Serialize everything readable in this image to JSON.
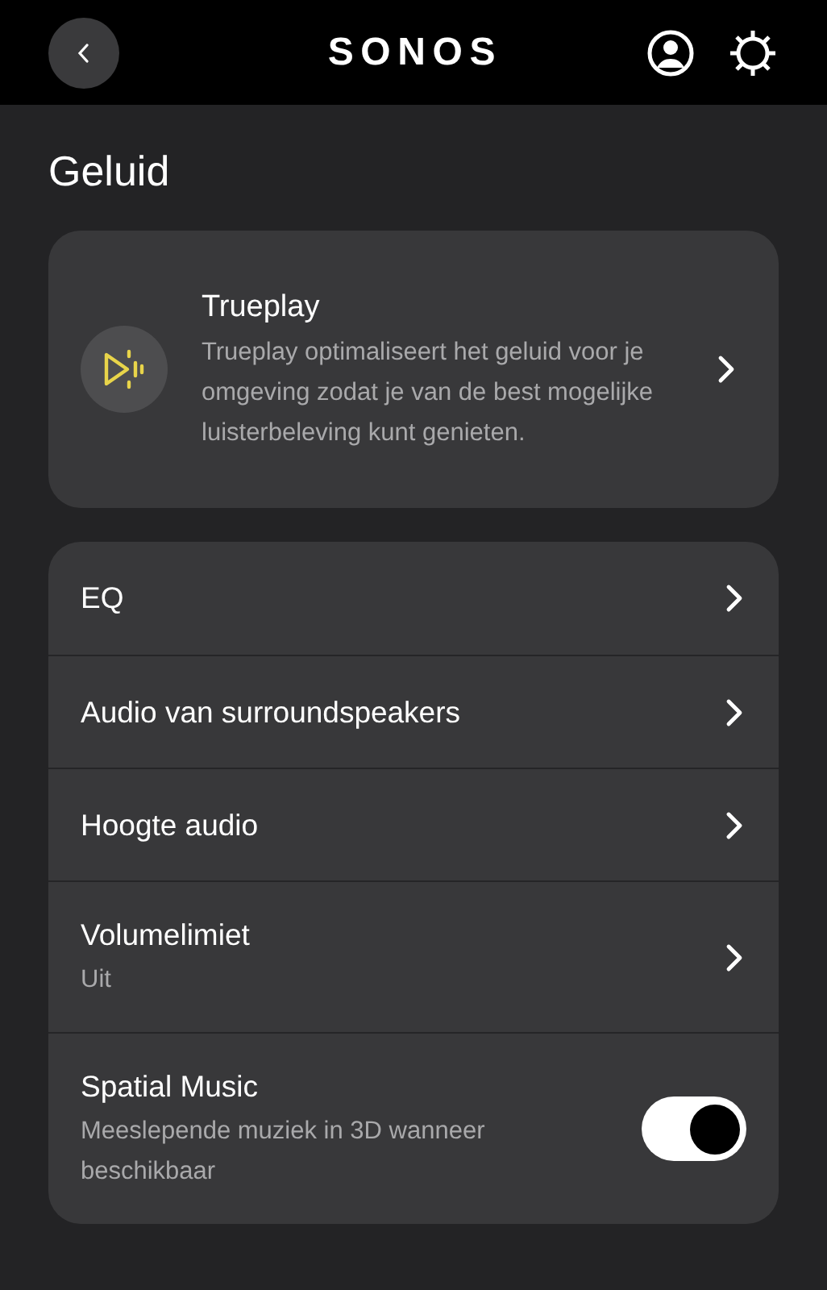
{
  "header": {
    "logo": "SONOS"
  },
  "page_title": "Geluid",
  "trueplay": {
    "title": "Trueplay",
    "description": "Trueplay optimaliseert het geluid voor je omgeving zodat je van de best mogelijke luisterbeleving kunt genieten."
  },
  "settings": [
    {
      "kind": "link",
      "label": "EQ"
    },
    {
      "kind": "link",
      "label": "Audio van surroundspeakers"
    },
    {
      "kind": "link",
      "label": "Hoogte audio"
    },
    {
      "kind": "link",
      "label": "Volumelimiet",
      "value": "Uit"
    },
    {
      "kind": "toggle",
      "label": "Spatial Music",
      "value": "Meeslepende muziek in 3D wanneer beschikbaar",
      "on": true
    }
  ]
}
